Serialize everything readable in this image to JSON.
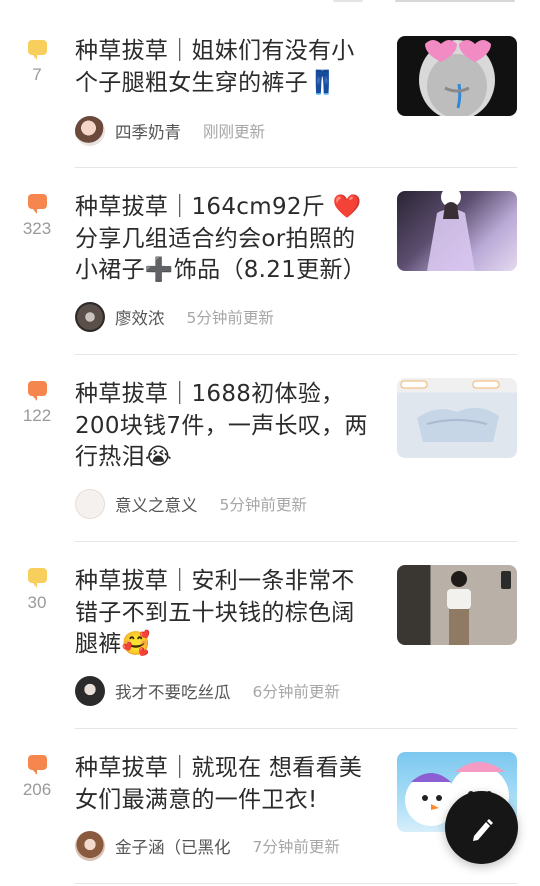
{
  "posts": [
    {
      "count": "7",
      "bubble_color": "#f8cf5c",
      "bubble_icon": "comment-bubble-icon",
      "title": "种草拔草｜姐妹们有没有小个子腿粗女生穿的裤子👖",
      "author": "四季奶青",
      "time": "刚刚更新",
      "thumb_desc": "meme-face-image"
    },
    {
      "count": "323",
      "bubble_color": "#f5874e",
      "bubble_icon": "comment-bubble-icon",
      "title": "种草拔草｜164cm92斤 ❤️ 分享几组适合约会or拍照的小裙子➕饰品（8.21更新）",
      "author": "廖效浓",
      "time": "5分钟前更新",
      "thumb_desc": "purple-dress-photo"
    },
    {
      "count": "122",
      "bubble_color": "#f5874e",
      "bubble_icon": "comment-bubble-icon",
      "title": "种草拔草｜1688初体验，200块钱7件，一声长叹，两行热泪😭",
      "author": "意义之意义",
      "time": "5分钟前更新",
      "thumb_desc": "clothes-package-photo"
    },
    {
      "count": "30",
      "bubble_color": "#f8cf5c",
      "bubble_icon": "comment-bubble-icon",
      "title": "种草拔草｜安利一条非常不错子不到五十块钱的棕色阔腿裤🥰",
      "author": "我才不要吃丝瓜",
      "time": "6分钟前更新",
      "thumb_desc": "mirror-selfie-photo"
    },
    {
      "count": "206",
      "bubble_color": "#f5874e",
      "bubble_icon": "comment-bubble-icon",
      "title": "种草拔草｜就现在 想看看美女们最满意的一件卫衣!",
      "author": "金子涵（已黑化",
      "time": "7分钟前更新",
      "thumb_desc": "snowman-figures-photo"
    }
  ],
  "fab": {
    "icon": "pen-icon"
  }
}
